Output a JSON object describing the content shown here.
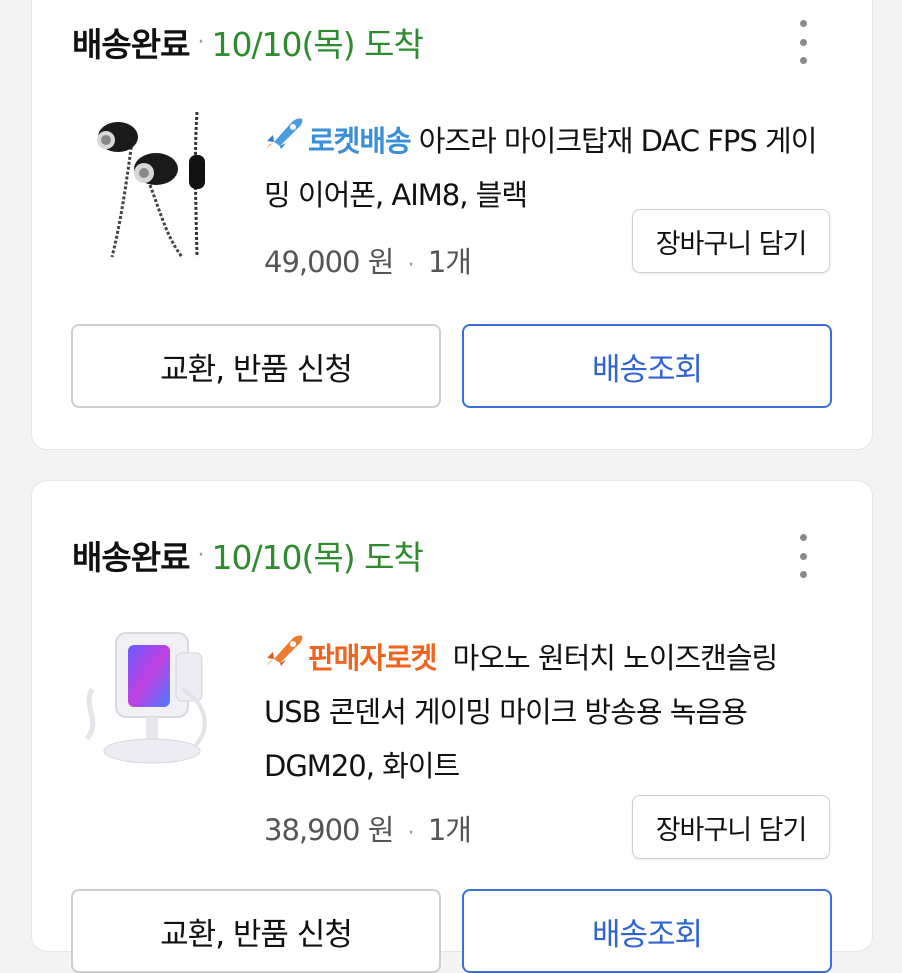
{
  "orders": [
    {
      "status": "배송완료",
      "dot": "·",
      "arrival": "10/10(목) 도착",
      "badge": "로켓배송",
      "badge_type": "rocket-delivery",
      "product_name": "아즈라 마이크탑재 DAC FPS 게이밍 이어폰, AIM8, 블랙",
      "price": "49,000 원",
      "price_dot": "·",
      "quantity": "1개",
      "cart_button": "장바구니 담기",
      "left_button": "교환, 반품 신청",
      "right_button": "배송조회",
      "thumbnail_icon": "earphones-image"
    },
    {
      "status": "배송완료",
      "dot": "·",
      "arrival": "10/10(목) 도착",
      "badge": "판매자로켓",
      "badge_type": "seller-rocket",
      "product_name": "마오노 원터치 노이즈캔슬링 USB 콘덴서 게이밍 마이크 방송용 녹음용 DGM20, 화이트",
      "price": "38,900 원",
      "price_dot": "·",
      "quantity": "1개",
      "cart_button": "장바구니 담기",
      "left_button": "교환, 반품 신청",
      "right_button": "배송조회",
      "thumbnail_icon": "microphone-image"
    }
  ],
  "colors": {
    "arrival_green": "#2e8b2e",
    "rocket_blue": "#3a8fd6",
    "seller_orange": "#f06420",
    "primary_blue": "#2f64d2"
  }
}
